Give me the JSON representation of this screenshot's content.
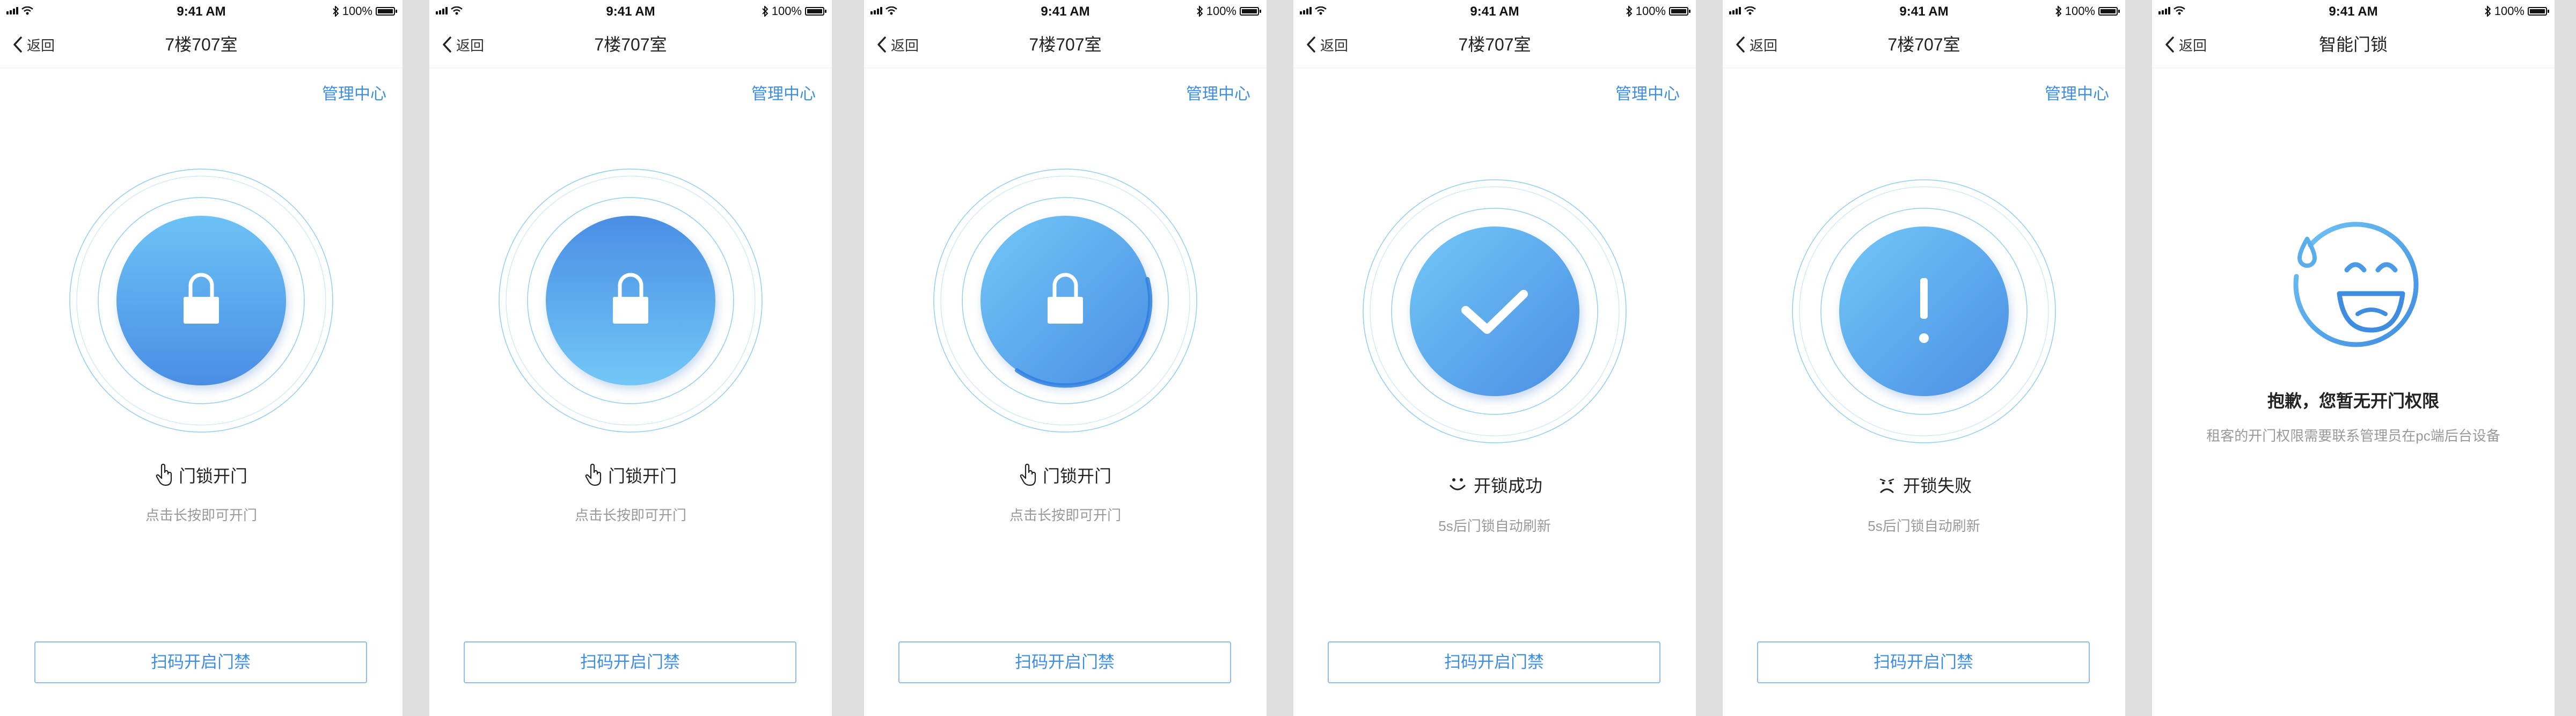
{
  "status_bar": {
    "time": "9:41 AM",
    "battery": "100%"
  },
  "nav": {
    "back_label": "返回",
    "room_title": "7楼707室",
    "lock_title": "智能门锁"
  },
  "management_link": "管理中心",
  "states": {
    "open": {
      "label": "门锁开门",
      "hint": "点击长按即可开门"
    },
    "success": {
      "label": "开锁成功",
      "hint": "5s后门锁自动刷新"
    },
    "failure": {
      "label": "开锁失败",
      "hint": "5s后门锁自动刷新"
    }
  },
  "scan_button": "扫码开启门禁",
  "no_permission": {
    "title": "抱歉，您暂无开门权限",
    "description": "租客的开门权限需要联系管理员在pc端后台设备"
  },
  "colors": {
    "accent": "#3f8de0",
    "circle_light": "#6cc2f5",
    "circle_dark": "#4a8ee4",
    "ring": "#8fcdf2",
    "background": "#dfdfdf"
  },
  "icons": {
    "lock": "padlock-icon",
    "check": "checkmark-icon",
    "alert": "exclamation-icon",
    "hand": "hand-pointer-icon",
    "smile": "smile-face-icon",
    "sad": "sad-face-icon",
    "sweat": "sweat-smile-face-icon"
  }
}
